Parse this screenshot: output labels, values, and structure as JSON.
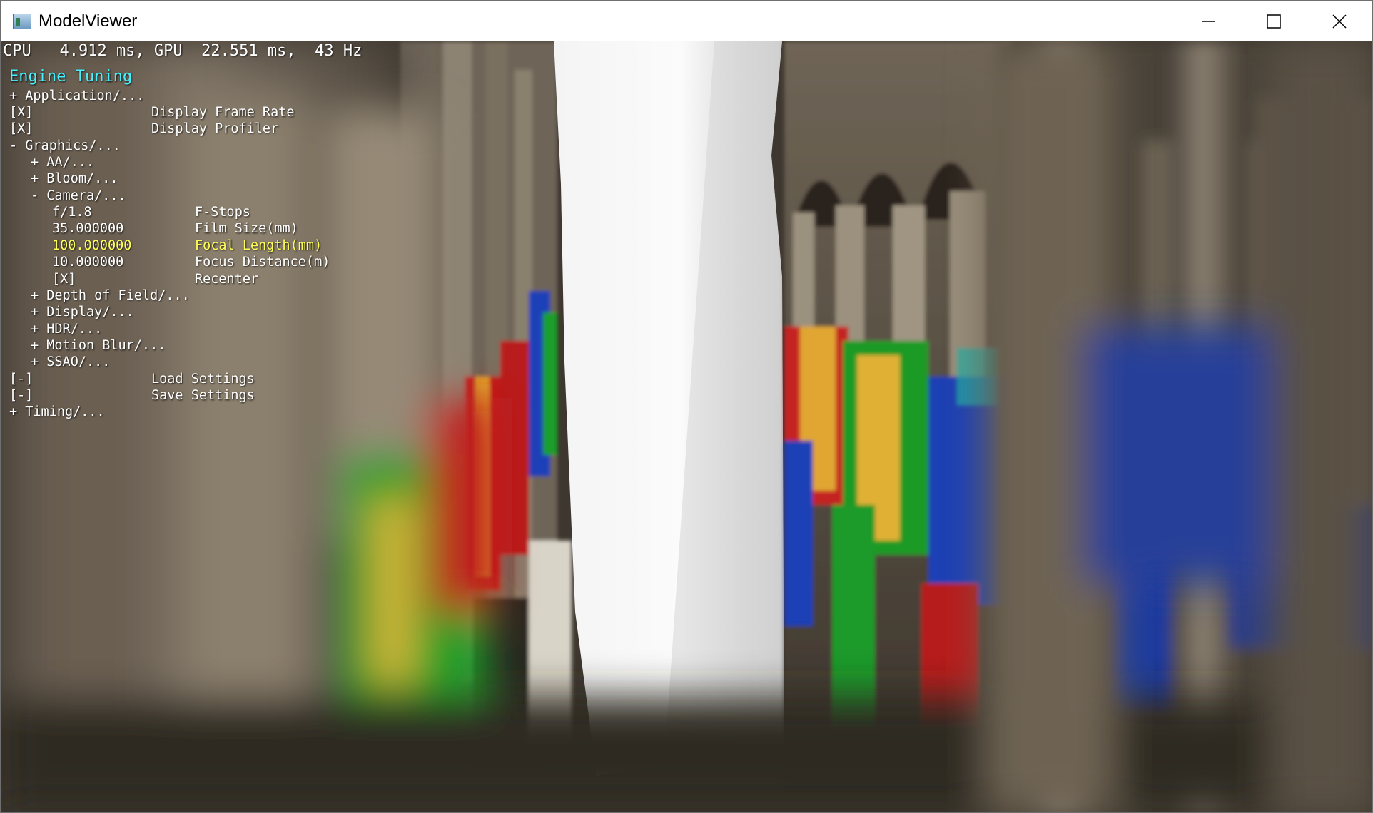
{
  "window": {
    "title": "ModelViewer",
    "controls": [
      "minimize-icon",
      "maximize-icon",
      "close-icon"
    ]
  },
  "perf": {
    "text": "CPU   4.912 ms, GPU  22.551 ms,  43 Hz"
  },
  "menu": {
    "title": "Engine Tuning",
    "application": "+ Application/...",
    "display_frame_rate": {
      "value": "[X]",
      "label": "Display Frame Rate"
    },
    "display_profiler": {
      "value": "[X]",
      "label": "Display Profiler"
    },
    "graphics": "- Graphics/...",
    "aa": "+ AA/...",
    "bloom": "+ Bloom/...",
    "camera": "- Camera/...",
    "f_stops": {
      "value": "f/1.8",
      "label": "F-Stops"
    },
    "film_size": {
      "value": "35.000000",
      "label": "Film Size(mm)"
    },
    "focal_length": {
      "value": "100.000000",
      "label": "Focal Length(mm)"
    },
    "focus_distance": {
      "value": "10.000000",
      "label": "Focus Distance(m)"
    },
    "recenter": {
      "value": "[X]",
      "label": "Recenter"
    },
    "depth_of_field": "+ Depth of Field/...",
    "display": "+ Display/...",
    "hdr": "+ HDR/...",
    "motion_blur": "+ Motion Blur/...",
    "ssao": "+ SSAO/...",
    "load_settings": {
      "value": "[-]",
      "label": "Load Settings"
    },
    "save_settings": {
      "value": "[-]",
      "label": "Save Settings"
    },
    "timing": "+ Timing/..."
  },
  "colors": {
    "menu_title": "#46f1ff",
    "highlight": "#fffe57",
    "text": "#ffffff"
  }
}
